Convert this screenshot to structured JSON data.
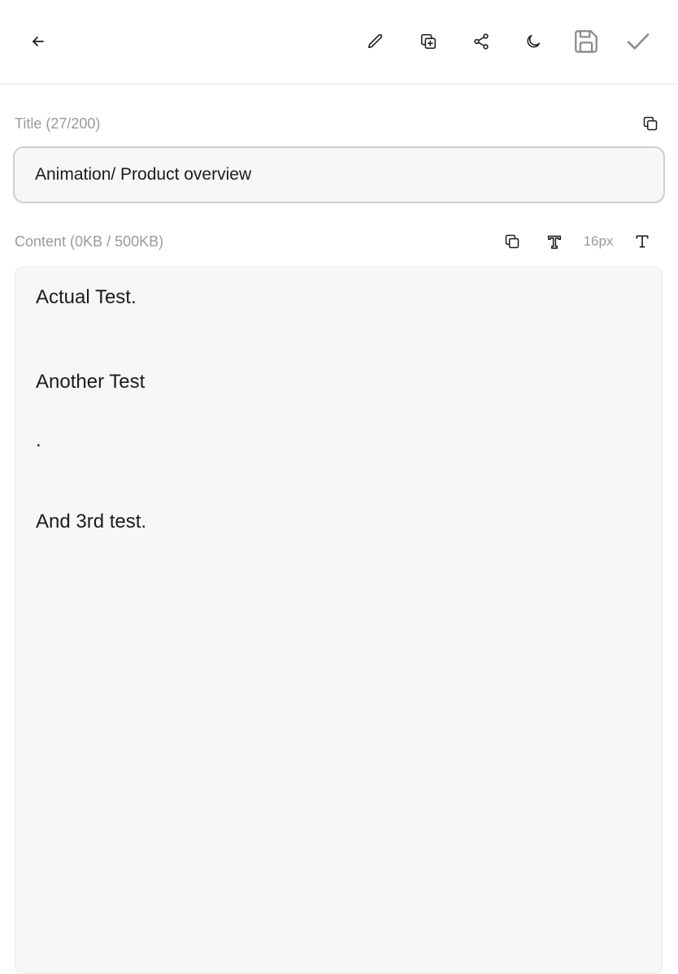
{
  "toolbar": {
    "back_icon": "arrow-left-icon",
    "edit_icon": "pencil-icon",
    "duplicate_icon": "copy-plus-icon",
    "share_icon": "share-icon",
    "theme_icon": "moon-icon",
    "save_icon": "floppy-disk-icon",
    "done_icon": "checkmark-icon"
  },
  "title_field": {
    "label": "Title (27/200)",
    "value": "Animation/ Product overview",
    "copy_icon": "copy-icon"
  },
  "content_field": {
    "label": "Content (0KB / 500KB)",
    "copy_icon": "copy-icon",
    "font_style_icon": "text-style-icon",
    "font_size": "16px",
    "text_icon": "text-icon",
    "lines": [
      "Actual Test.",
      "Another Test",
      ".",
      "And 3rd test."
    ]
  },
  "colors": {
    "accent_text": "#1c1c1c",
    "muted_text": "#9a9a9a",
    "field_bg": "#f7f7f7",
    "border": "#cfcfcf"
  }
}
